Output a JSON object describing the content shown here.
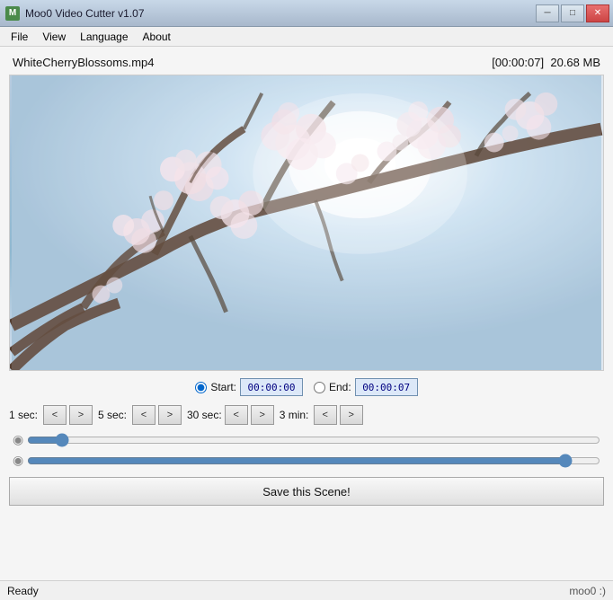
{
  "titleBar": {
    "appName": "Moo0 Video Cutter v1.07",
    "appIcon": "M",
    "controls": {
      "minimize": "─",
      "maximize": "□",
      "close": "✕"
    }
  },
  "menuBar": {
    "items": [
      {
        "id": "file",
        "label": "File"
      },
      {
        "id": "view",
        "label": "View"
      },
      {
        "id": "language",
        "label": "Language"
      },
      {
        "id": "about",
        "label": "About"
      }
    ]
  },
  "fileInfo": {
    "filename": "WhiteCherryBlossoms.mp4",
    "timecode": "[00:00:07]",
    "filesize": "20.68 MB"
  },
  "timeControls": {
    "startLabel": "Start:",
    "startValue": "00:00:00",
    "endLabel": "End:",
    "endValue": "00:00:07"
  },
  "stepControls": [
    {
      "id": "1sec",
      "label": "1 sec:",
      "back": "<",
      "forward": ">"
    },
    {
      "id": "5sec",
      "label": "5 sec:",
      "back": "<",
      "forward": ">"
    },
    {
      "id": "30sec",
      "label": "30 sec:",
      "back": "<",
      "forward": ">"
    },
    {
      "id": "3min",
      "label": "3 min:",
      "back": "<",
      "forward": ">"
    }
  ],
  "sliders": {
    "position": {
      "min": 0,
      "max": 100,
      "value": 5,
      "thumbIcon": "◉"
    },
    "range": {
      "min": 0,
      "max": 100,
      "value": 95,
      "thumbIcon": "◉"
    }
  },
  "saveButton": {
    "label": "Save this Scene!"
  },
  "statusBar": {
    "status": "Ready",
    "brand": "moo0 :)"
  }
}
